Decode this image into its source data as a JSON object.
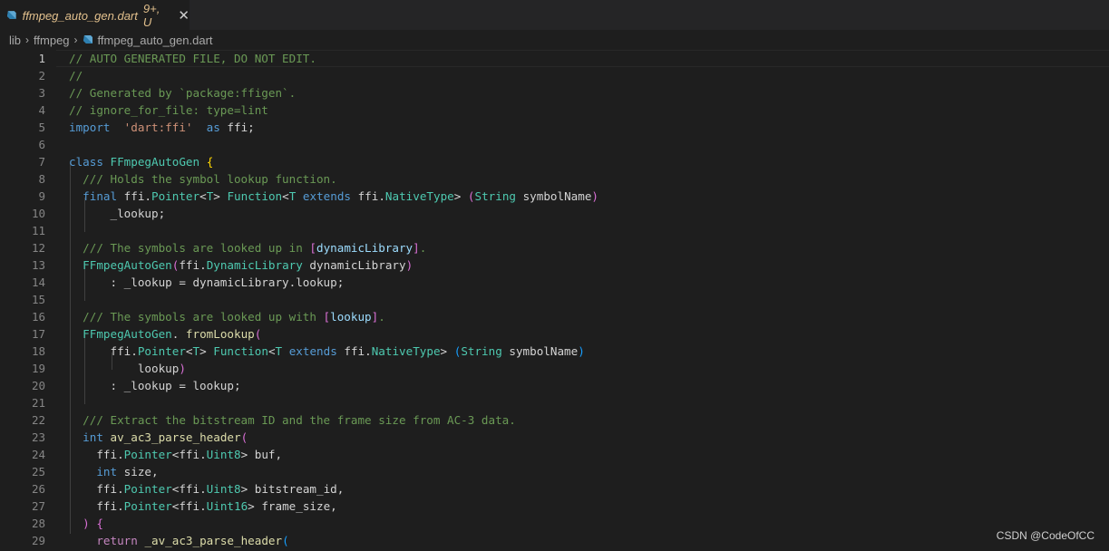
{
  "tab": {
    "file_name": "ffmpeg_auto_gen.dart",
    "status": "9+, U",
    "close_glyph": "✕",
    "icon": "dart-icon"
  },
  "breadcrumb": {
    "items": [
      "lib",
      "ffmpeg",
      "ffmpeg_auto_gen.dart"
    ],
    "separator": "›"
  },
  "editor": {
    "active_line": 1,
    "lines": [
      {
        "n": "1",
        "segs": [
          [
            "c",
            "// AUTO GENERATED FILE, DO NOT EDIT."
          ]
        ]
      },
      {
        "n": "2",
        "segs": [
          [
            "c",
            "//"
          ]
        ]
      },
      {
        "n": "3",
        "segs": [
          [
            "c",
            "// Generated by `package:ffigen`."
          ]
        ]
      },
      {
        "n": "4",
        "segs": [
          [
            "c",
            "// ignore_for_file: type=lint"
          ]
        ]
      },
      {
        "n": "5",
        "segs": [
          [
            "k",
            "import"
          ],
          [
            "",
            "  "
          ],
          [
            "s",
            "'dart:ffi'"
          ],
          [
            "",
            "  "
          ],
          [
            "k",
            "as"
          ],
          [
            "",
            " ffi;"
          ]
        ]
      },
      {
        "n": "6",
        "segs": []
      },
      {
        "n": "7",
        "segs": [
          [
            "k",
            "class"
          ],
          [
            "",
            " "
          ],
          [
            "t",
            "FFmpegAutoGen"
          ],
          [
            "",
            " "
          ],
          [
            "p1",
            "{"
          ]
        ]
      },
      {
        "n": "8",
        "segs": [
          [
            "",
            "  "
          ],
          [
            "c",
            "/// Holds the symbol lookup function."
          ]
        ]
      },
      {
        "n": "9",
        "segs": [
          [
            "",
            "  "
          ],
          [
            "k",
            "final"
          ],
          [
            "",
            " ffi."
          ],
          [
            "t",
            "Pointer"
          ],
          [
            "",
            "<"
          ],
          [
            "t",
            "T"
          ],
          [
            "",
            "> "
          ],
          [
            "t",
            "Function"
          ],
          [
            "",
            "<"
          ],
          [
            "t",
            "T"
          ],
          [
            "",
            " "
          ],
          [
            "k",
            "extends"
          ],
          [
            "",
            " ffi."
          ],
          [
            "t",
            "NativeType"
          ],
          [
            "",
            "> "
          ],
          [
            "p2",
            "("
          ],
          [
            "t",
            "String"
          ],
          [
            "",
            " symbolName"
          ],
          [
            "p2",
            ")"
          ]
        ]
      },
      {
        "n": "10",
        "segs": [
          [
            "",
            "      _lookup;"
          ]
        ]
      },
      {
        "n": "11",
        "segs": []
      },
      {
        "n": "12",
        "segs": [
          [
            "",
            "  "
          ],
          [
            "c",
            "/// The symbols are looked up in "
          ],
          [
            "p2",
            "["
          ],
          [
            "v",
            "dynamicLibrary"
          ],
          [
            "p2",
            "]"
          ],
          [
            "c",
            "."
          ]
        ]
      },
      {
        "n": "13",
        "segs": [
          [
            "",
            "  "
          ],
          [
            "t",
            "FFmpegAutoGen"
          ],
          [
            "p2",
            "("
          ],
          [
            "",
            "ffi."
          ],
          [
            "t",
            "DynamicLibrary"
          ],
          [
            "",
            " dynamicLibrary"
          ],
          [
            "p2",
            ")"
          ]
        ]
      },
      {
        "n": "14",
        "segs": [
          [
            "",
            "      : _lookup = dynamicLibrary.lookup;"
          ]
        ]
      },
      {
        "n": "15",
        "segs": []
      },
      {
        "n": "16",
        "segs": [
          [
            "",
            "  "
          ],
          [
            "c",
            "/// The symbols are looked up with "
          ],
          [
            "p2",
            "["
          ],
          [
            "v",
            "lookup"
          ],
          [
            "p2",
            "]"
          ],
          [
            "c",
            "."
          ]
        ]
      },
      {
        "n": "17",
        "segs": [
          [
            "",
            "  "
          ],
          [
            "t",
            "FFmpegAutoGen"
          ],
          [
            "",
            ". "
          ],
          [
            "f",
            "fromLookup"
          ],
          [
            "p2",
            "("
          ]
        ]
      },
      {
        "n": "18",
        "segs": [
          [
            "",
            "      ffi."
          ],
          [
            "t",
            "Pointer"
          ],
          [
            "",
            "<"
          ],
          [
            "t",
            "T"
          ],
          [
            "",
            "> "
          ],
          [
            "t",
            "Function"
          ],
          [
            "",
            "<"
          ],
          [
            "t",
            "T"
          ],
          [
            "",
            " "
          ],
          [
            "k",
            "extends"
          ],
          [
            "",
            " ffi."
          ],
          [
            "t",
            "NativeType"
          ],
          [
            "",
            "> "
          ],
          [
            "p3",
            "("
          ],
          [
            "t",
            "String"
          ],
          [
            "",
            " symbolName"
          ],
          [
            "p3",
            ")"
          ]
        ]
      },
      {
        "n": "19",
        "segs": [
          [
            "",
            "          lookup"
          ],
          [
            "p2",
            ")"
          ]
        ]
      },
      {
        "n": "20",
        "segs": [
          [
            "",
            "      : _lookup = lookup;"
          ]
        ]
      },
      {
        "n": "21",
        "segs": []
      },
      {
        "n": "22",
        "segs": [
          [
            "",
            "  "
          ],
          [
            "c",
            "/// Extract the bitstream ID and the frame size from AC-3 data."
          ]
        ]
      },
      {
        "n": "23",
        "segs": [
          [
            "",
            "  "
          ],
          [
            "k",
            "int"
          ],
          [
            "",
            " "
          ],
          [
            "f",
            "av_ac3_parse_header"
          ],
          [
            "p2",
            "("
          ]
        ]
      },
      {
        "n": "24",
        "segs": [
          [
            "",
            "    ffi."
          ],
          [
            "t",
            "Pointer"
          ],
          [
            "",
            "<ffi."
          ],
          [
            "t",
            "Uint8"
          ],
          [
            "",
            "> buf,"
          ]
        ]
      },
      {
        "n": "25",
        "segs": [
          [
            "",
            "    "
          ],
          [
            "k",
            "int"
          ],
          [
            "",
            " size,"
          ]
        ]
      },
      {
        "n": "26",
        "segs": [
          [
            "",
            "    ffi."
          ],
          [
            "t",
            "Pointer"
          ],
          [
            "",
            "<ffi."
          ],
          [
            "t",
            "Uint8"
          ],
          [
            "",
            "> bitstream_id,"
          ]
        ]
      },
      {
        "n": "27",
        "segs": [
          [
            "",
            "    ffi."
          ],
          [
            "t",
            "Pointer"
          ],
          [
            "",
            "<ffi."
          ],
          [
            "t",
            "Uint16"
          ],
          [
            "",
            "> frame_size,"
          ]
        ]
      },
      {
        "n": "28",
        "segs": [
          [
            "",
            "  "
          ],
          [
            "p2",
            ")"
          ],
          [
            "",
            " "
          ],
          [
            "p2",
            "{"
          ]
        ]
      },
      {
        "n": "29",
        "segs": [
          [
            "",
            "    "
          ],
          [
            "kc",
            "return"
          ],
          [
            "",
            " "
          ],
          [
            "f",
            "_av_ac3_parse_header"
          ],
          [
            "p3",
            "("
          ]
        ]
      }
    ]
  },
  "watermark": "CSDN @CodeOfCC"
}
